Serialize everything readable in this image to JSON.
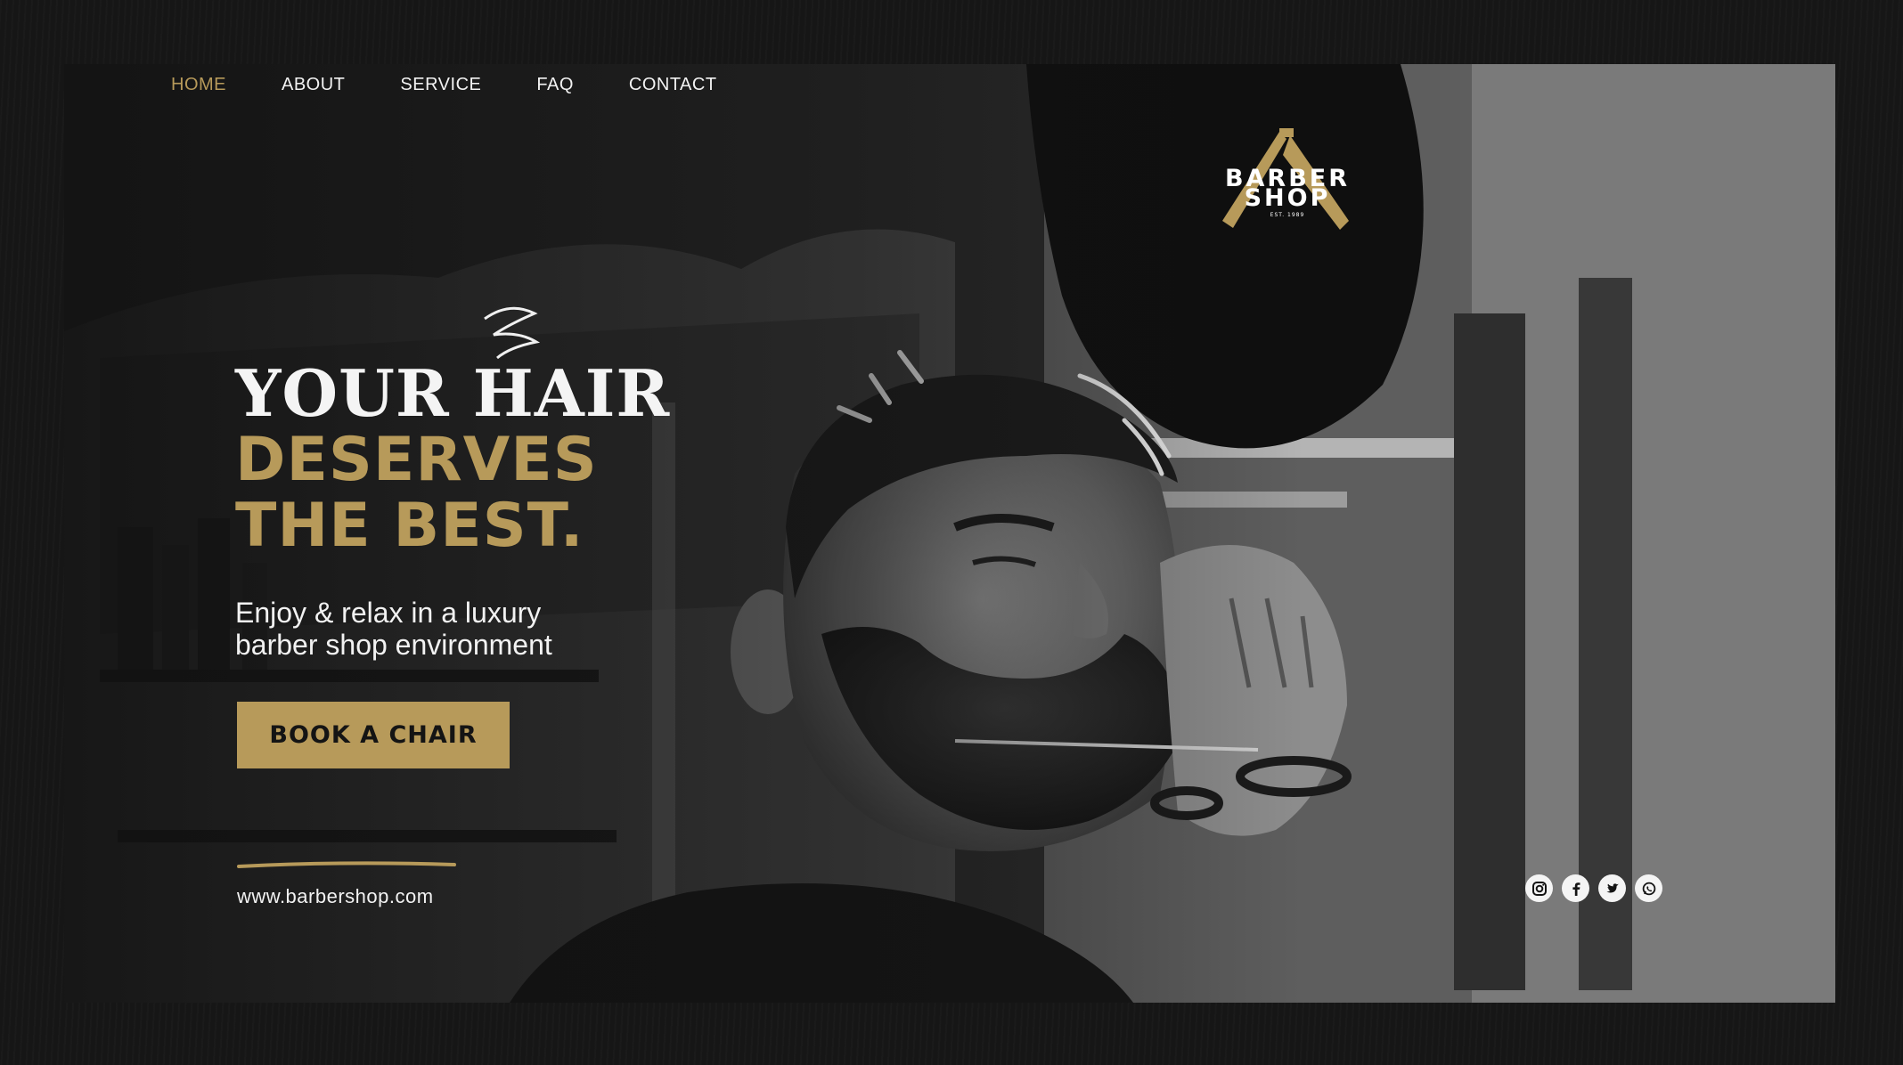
{
  "nav": {
    "items": [
      {
        "label": "HOME",
        "active": true
      },
      {
        "label": "ABOUT",
        "active": false
      },
      {
        "label": "SERVICE",
        "active": false
      },
      {
        "label": "FAQ",
        "active": false
      },
      {
        "label": "CONTACT",
        "active": false
      }
    ]
  },
  "logo": {
    "line1": "BARBER",
    "line2": "SHOP",
    "est": "EST. 1989"
  },
  "hero": {
    "headline_line1": "YOUR HAIR",
    "headline_line2": "DESERVES",
    "headline_line3": "THE BEST.",
    "tagline_line1": "Enjoy & relax in a luxury",
    "tagline_line2": "barber shop environment",
    "cta_label": "BOOK A CHAIR",
    "website": "www.barbershop.com"
  },
  "social": [
    {
      "icon": "instagram-icon"
    },
    {
      "icon": "facebook-icon"
    },
    {
      "icon": "twitter-icon"
    },
    {
      "icon": "whatsapp-icon"
    }
  ],
  "colors": {
    "accent_gold": "#b79a5a",
    "text_light": "#f2f2f2",
    "background": "#141414"
  }
}
